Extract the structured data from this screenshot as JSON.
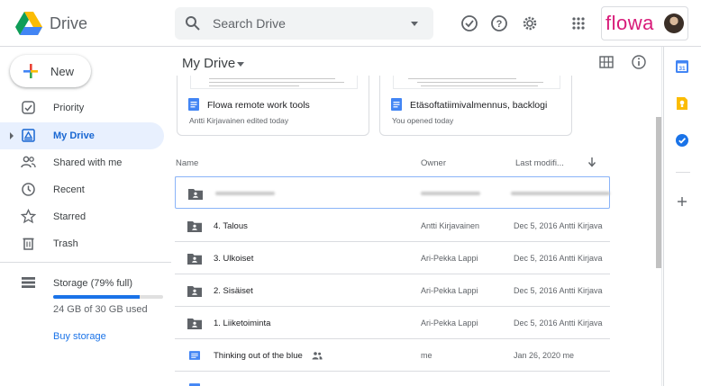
{
  "header": {
    "app_name": "Drive",
    "search_placeholder": "Search Drive",
    "brand": "flowa"
  },
  "sidebar": {
    "new_label": "New",
    "items": [
      {
        "label": "Priority",
        "icon": "priority-icon",
        "active": false
      },
      {
        "label": "My Drive",
        "icon": "my-drive-icon",
        "active": true
      },
      {
        "label": "Shared with me",
        "icon": "shared-icon",
        "active": false
      },
      {
        "label": "Recent",
        "icon": "clock-icon",
        "active": false
      },
      {
        "label": "Starred",
        "icon": "star-icon",
        "active": false
      },
      {
        "label": "Trash",
        "icon": "trash-icon",
        "active": false
      }
    ],
    "storage": {
      "label": "Storage (79% full)",
      "used_text": "24 GB of 30 GB used",
      "fraction": 0.79,
      "buy_label": "Buy storage"
    }
  },
  "main": {
    "title": "My Drive",
    "suggested": [
      {
        "title": "Flowa remote work tools",
        "subtitle": "Antti Kirjavainen edited today"
      },
      {
        "title": "Etäsoftatiimivalmennus, backlogi",
        "subtitle": "You opened today"
      }
    ],
    "columns": {
      "name": "Name",
      "owner": "Owner",
      "modified": "Last modifi..."
    },
    "rows": [
      {
        "type": "shared-folder",
        "name": "",
        "owner": "",
        "modified": "",
        "redacted": true
      },
      {
        "type": "shared-folder",
        "name": "4. Talous",
        "owner": "Antti Kirjavainen",
        "modified": "Dec 5, 2016 Antti Kirjava"
      },
      {
        "type": "shared-folder",
        "name": "3. Ulkoiset",
        "owner": "Ari-Pekka Lappi",
        "modified": "Dec 5, 2016 Antti Kirjava"
      },
      {
        "type": "shared-folder",
        "name": "2. Sisäiset",
        "owner": "Ari-Pekka Lappi",
        "modified": "Dec 5, 2016 Antti Kirjava"
      },
      {
        "type": "shared-folder",
        "name": "1. Liiketoiminta",
        "owner": "Ari-Pekka Lappi",
        "modified": "Dec 5, 2016 Antti Kirjava"
      },
      {
        "type": "doc",
        "name": "Thinking out of the blue",
        "owner": "me",
        "modified": "Jan 26, 2020 me",
        "shared": true
      }
    ]
  },
  "colors": {
    "accent": "#1a73e8",
    "active_bg": "#e8f0fe",
    "brand": "#d81b79"
  }
}
